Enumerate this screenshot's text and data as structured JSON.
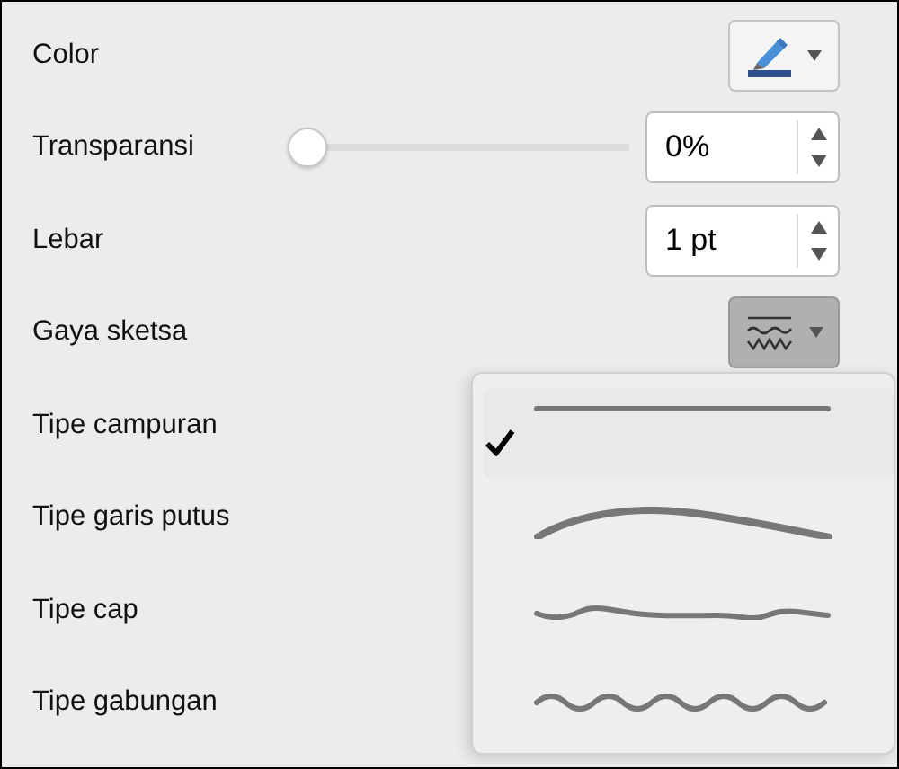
{
  "rows": [
    {
      "label": "Color",
      "kind": "color"
    },
    {
      "label": "Transparansi",
      "kind": "slider",
      "level": 0,
      "value": "0%"
    },
    {
      "label": "Lebar",
      "kind": "spinner",
      "value": "1 pt"
    },
    {
      "label": "Gaya sketsa",
      "kind": "sketch",
      "expanded": true
    },
    {
      "label": "Tipe campuran",
      "kind": "plain"
    },
    {
      "label": "Tipe garis putus",
      "kind": "plain"
    },
    {
      "label": "Tipe cap",
      "kind": "plain"
    },
    {
      "label": "Tipe gabungan",
      "kind": "plain"
    }
  ],
  "sketch_menu": {
    "options": [
      {
        "kind": "straight",
        "selected": true
      },
      {
        "kind": "curve",
        "selected": false
      },
      {
        "kind": "wavy",
        "selected": false
      },
      {
        "kind": "squiggle",
        "selected": false
      }
    ]
  }
}
